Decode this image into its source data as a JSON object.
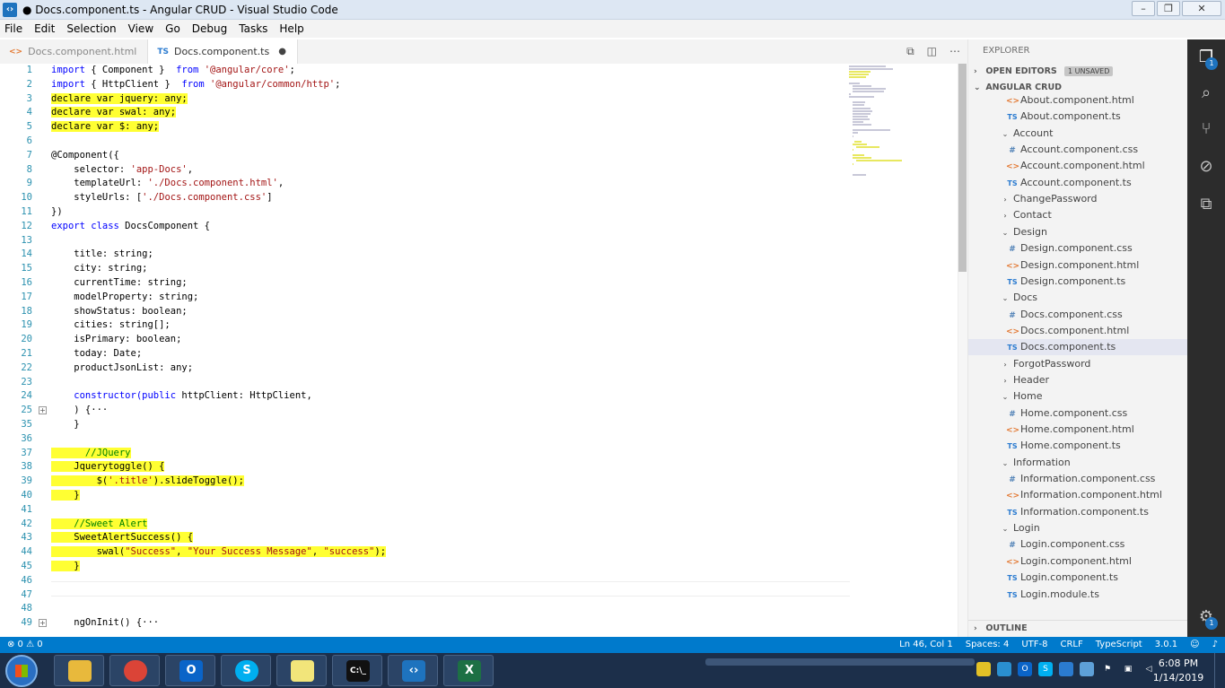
{
  "window": {
    "title": "● Docs.component.ts - Angular CRUD - Visual Studio Code",
    "app_icon": "vscode-icon"
  },
  "menu": [
    "File",
    "Edit",
    "Selection",
    "View",
    "Go",
    "Debug",
    "Tasks",
    "Help"
  ],
  "tabs": [
    {
      "label": "Docs.component.html",
      "icon": "<>",
      "active": false
    },
    {
      "label": "Docs.component.ts",
      "icon": "TS",
      "active": true,
      "dirty": "●"
    }
  ],
  "editor": {
    "lines": [
      {
        "n": "1",
        "hl": false,
        "parts": [
          [
            "kw",
            "import"
          ],
          [
            "",
            "{ Component } "
          ],
          [
            "kw",
            "from"
          ],
          [
            "str",
            " '@angular/core'"
          ],
          [
            "",
            ";"
          ]
        ]
      },
      {
        "n": "2",
        "hl": false,
        "parts": [
          [
            "kw",
            "import"
          ],
          [
            "",
            "{ HttpClient } "
          ],
          [
            "kw",
            "from"
          ],
          [
            "str",
            " '@angular/common/http'"
          ],
          [
            "",
            ";"
          ]
        ]
      },
      {
        "n": "3",
        "hl": true,
        "parts": [
          [
            "",
            "declare var jquery: any;"
          ]
        ]
      },
      {
        "n": "4",
        "hl": true,
        "parts": [
          [
            "",
            "declare var swal: any;"
          ]
        ]
      },
      {
        "n": "5",
        "hl": true,
        "parts": [
          [
            "",
            "declare var $: any;"
          ]
        ]
      },
      {
        "n": "6",
        "hl": false,
        "parts": [
          [
            "",
            ""
          ]
        ]
      },
      {
        "n": "7",
        "hl": false,
        "parts": [
          [
            "",
            "@Component({"
          ]
        ]
      },
      {
        "n": "8",
        "hl": false,
        "parts": [
          [
            "",
            "    selector: "
          ],
          [
            "str",
            "'app-Docs'"
          ],
          [
            "",
            ","
          ]
        ]
      },
      {
        "n": "9",
        "hl": false,
        "parts": [
          [
            "",
            "    templateUrl: "
          ],
          [
            "str",
            "'./Docs.component.html'"
          ],
          [
            "",
            ","
          ]
        ]
      },
      {
        "n": "10",
        "hl": false,
        "parts": [
          [
            "",
            "    styleUrls: ["
          ],
          [
            "str",
            "'./Docs.component.css'"
          ],
          [
            "",
            "]"
          ]
        ]
      },
      {
        "n": "11",
        "hl": false,
        "parts": [
          [
            "",
            "})"
          ]
        ]
      },
      {
        "n": "12",
        "hl": false,
        "parts": [
          [
            "kw",
            "export class"
          ],
          [
            "",
            " DocsComponent {"
          ]
        ]
      },
      {
        "n": "13",
        "hl": false,
        "parts": [
          [
            "",
            ""
          ]
        ]
      },
      {
        "n": "14",
        "hl": false,
        "parts": [
          [
            "",
            "    title: string;"
          ]
        ]
      },
      {
        "n": "15",
        "hl": false,
        "parts": [
          [
            "",
            "    city: string;"
          ]
        ]
      },
      {
        "n": "16",
        "hl": false,
        "parts": [
          [
            "",
            "    currentTime: string;"
          ]
        ]
      },
      {
        "n": "17",
        "hl": false,
        "parts": [
          [
            "",
            "    modelProperty: string;"
          ]
        ]
      },
      {
        "n": "18",
        "hl": false,
        "parts": [
          [
            "",
            "    showStatus: boolean;"
          ]
        ]
      },
      {
        "n": "19",
        "hl": false,
        "parts": [
          [
            "",
            "    cities: string[];"
          ]
        ]
      },
      {
        "n": "20",
        "hl": false,
        "parts": [
          [
            "",
            "    isPrimary: boolean;"
          ]
        ]
      },
      {
        "n": "21",
        "hl": false,
        "parts": [
          [
            "",
            "    today: Date;"
          ]
        ]
      },
      {
        "n": "22",
        "hl": false,
        "parts": [
          [
            "",
            "    productJsonList: any;"
          ]
        ]
      },
      {
        "n": "23",
        "hl": false,
        "parts": [
          [
            "",
            ""
          ]
        ]
      },
      {
        "n": "24",
        "hl": false,
        "parts": [
          [
            "kw",
            "    constructor(public"
          ],
          [
            "",
            " httpClient: HttpClient,"
          ]
        ]
      },
      {
        "n": "25",
        "hl": false,
        "fold": true,
        "parts": [
          [
            "",
            "    ) {···"
          ]
        ]
      },
      {
        "n": "35",
        "hl": false,
        "parts": [
          [
            "",
            "    }"
          ]
        ]
      },
      {
        "n": "36",
        "hl": false,
        "parts": [
          [
            "",
            ""
          ]
        ]
      },
      {
        "n": "37",
        "hl": true,
        "parts": [
          [
            "cm",
            "      //JQuery"
          ]
        ]
      },
      {
        "n": "38",
        "hl": true,
        "parts": [
          [
            "",
            "    Jquerytoggle() {"
          ]
        ]
      },
      {
        "n": "39",
        "hl": true,
        "parts": [
          [
            "",
            "        $("
          ],
          [
            "str",
            "'.title'"
          ],
          [
            "",
            ").slideToggle();"
          ]
        ]
      },
      {
        "n": "40",
        "hl": true,
        "parts": [
          [
            "",
            "    }"
          ]
        ]
      },
      {
        "n": "41",
        "hl": false,
        "parts": [
          [
            "",
            ""
          ]
        ]
      },
      {
        "n": "42",
        "hl": true,
        "parts": [
          [
            "cm",
            "    //Sweet Alert"
          ]
        ]
      },
      {
        "n": "43",
        "hl": true,
        "parts": [
          [
            "",
            "    SweetAlertSuccess() {"
          ]
        ]
      },
      {
        "n": "44",
        "hl": true,
        "parts": [
          [
            "",
            "        swal("
          ],
          [
            "str",
            "\"Success\""
          ],
          [
            "",
            ", "
          ],
          [
            "str",
            "\"Your Success Message\""
          ],
          [
            "",
            ", "
          ],
          [
            "str",
            "\"success\""
          ],
          [
            "",
            ");"
          ]
        ]
      },
      {
        "n": "45",
        "hl": true,
        "parts": [
          [
            "",
            "    }"
          ]
        ]
      },
      {
        "n": "46",
        "hl": false,
        "parts": [
          [
            "",
            ""
          ]
        ]
      },
      {
        "n": "47",
        "hl": false,
        "parts": [
          [
            "",
            ""
          ]
        ]
      },
      {
        "n": "48",
        "hl": false,
        "parts": [
          [
            "",
            ""
          ]
        ]
      },
      {
        "n": "49",
        "hl": false,
        "fold": true,
        "parts": [
          [
            "",
            "    ngOnInit() {···"
          ]
        ]
      }
    ]
  },
  "sidebar": {
    "title": "EXPLORER",
    "open_editors": {
      "label": "OPEN EDITORS",
      "badge": "1 UNSAVED"
    },
    "project": "ANGULAR CRUD",
    "outline": "OUTLINE",
    "tree": [
      {
        "t": "html",
        "label": "About.component.html",
        "d": 2
      },
      {
        "t": "ts",
        "label": "About.component.ts",
        "d": 2
      },
      {
        "t": "folder-open",
        "label": "Account",
        "d": 1
      },
      {
        "t": "css",
        "label": "Account.component.css",
        "d": 2
      },
      {
        "t": "html",
        "label": "Account.component.html",
        "d": 2
      },
      {
        "t": "ts",
        "label": "Account.component.ts",
        "d": 2
      },
      {
        "t": "folder",
        "label": "ChangePassword",
        "d": 1
      },
      {
        "t": "folder",
        "label": "Contact",
        "d": 1
      },
      {
        "t": "folder-open",
        "label": "Design",
        "d": 1
      },
      {
        "t": "css",
        "label": "Design.component.css",
        "d": 2
      },
      {
        "t": "html",
        "label": "Design.component.html",
        "d": 2
      },
      {
        "t": "ts",
        "label": "Design.component.ts",
        "d": 2
      },
      {
        "t": "folder-open",
        "label": "Docs",
        "d": 1
      },
      {
        "t": "css",
        "label": "Docs.component.css",
        "d": 2
      },
      {
        "t": "html",
        "label": "Docs.component.html",
        "d": 2
      },
      {
        "t": "ts",
        "label": "Docs.component.ts",
        "d": 2,
        "sel": true
      },
      {
        "t": "folder",
        "label": "ForgotPassword",
        "d": 1
      },
      {
        "t": "folder",
        "label": "Header",
        "d": 1
      },
      {
        "t": "folder-open",
        "label": "Home",
        "d": 1
      },
      {
        "t": "css",
        "label": "Home.component.css",
        "d": 2
      },
      {
        "t": "html",
        "label": "Home.component.html",
        "d": 2
      },
      {
        "t": "ts",
        "label": "Home.component.ts",
        "d": 2
      },
      {
        "t": "folder-open",
        "label": "Information",
        "d": 1
      },
      {
        "t": "css",
        "label": "Information.component.css",
        "d": 2
      },
      {
        "t": "html",
        "label": "Information.component.html",
        "d": 2
      },
      {
        "t": "ts",
        "label": "Information.component.ts",
        "d": 2
      },
      {
        "t": "folder-open",
        "label": "Login",
        "d": 1
      },
      {
        "t": "css",
        "label": "Login.component.css",
        "d": 2
      },
      {
        "t": "html",
        "label": "Login.component.html",
        "d": 2
      },
      {
        "t": "ts",
        "label": "Login.component.ts",
        "d": 2
      },
      {
        "t": "ts",
        "label": "Login.module.ts",
        "d": 2
      }
    ]
  },
  "activity": {
    "explorer_badge": "1",
    "settings_badge": "1"
  },
  "status": {
    "problems": "⊗ 0 ⚠ 0",
    "position": "Ln 46, Col 1",
    "spaces": "Spaces: 4",
    "encoding": "UTF-8",
    "eol": "CRLF",
    "language": "TypeScript",
    "version": "3.0.1"
  },
  "taskbar": {
    "time": "6:08 PM",
    "date": "1/14/2019"
  },
  "colors": {
    "highlight": "#ffff33",
    "statusbar": "#007acc",
    "activitybar": "#2c2c2c"
  }
}
